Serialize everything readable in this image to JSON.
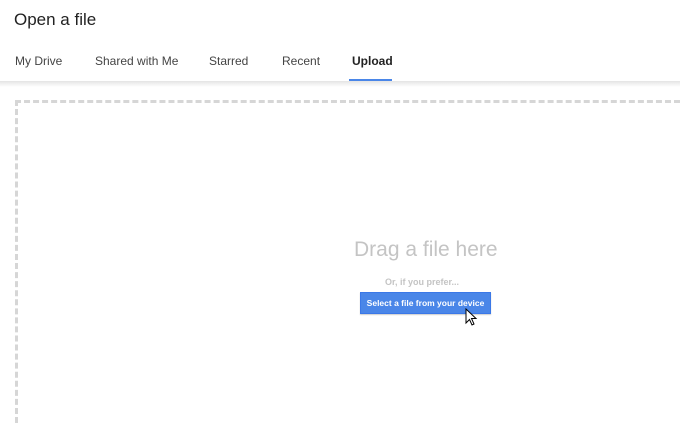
{
  "dialog": {
    "title": "Open a file"
  },
  "tabs": [
    {
      "label": "My Drive",
      "active": false
    },
    {
      "label": "Shared with Me",
      "active": false
    },
    {
      "label": "Starred",
      "active": false
    },
    {
      "label": "Recent",
      "active": false
    },
    {
      "label": "Upload",
      "active": true
    }
  ],
  "upload": {
    "drag_text": "Drag a file here",
    "prefer_text": "Or, if you prefer...",
    "select_button": "Select a file from your device"
  },
  "colors": {
    "accent": "#4a86e8"
  }
}
